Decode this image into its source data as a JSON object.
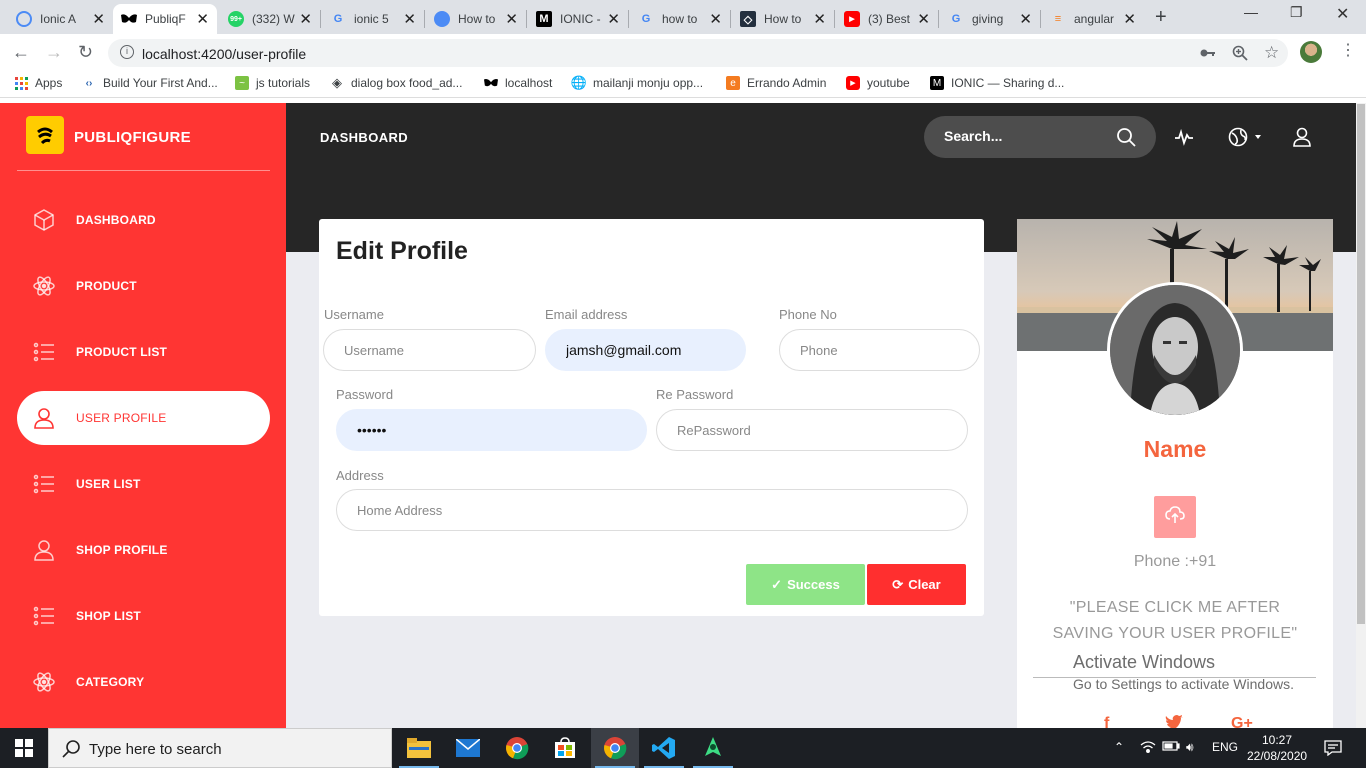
{
  "browser": {
    "tabs": [
      {
        "title": "Ionic A",
        "favicon": "ionic-logo",
        "color": "#4c8bf5"
      },
      {
        "title": "PubliqF",
        "favicon": "mask-icon",
        "color": "#000000"
      },
      {
        "title": "(332) W",
        "favicon": "whatsapp-icon",
        "color": "#25d366"
      },
      {
        "title": "ionic 5",
        "favicon": "google-icon",
        "color": "#4285f4"
      },
      {
        "title": "How to",
        "favicon": "blue-circle-icon",
        "color": "#4c8bf5"
      },
      {
        "title": "IONIC -",
        "favicon": "medium-icon",
        "color": "#000000"
      },
      {
        "title": "how to",
        "favicon": "google-icon",
        "color": "#4285f4"
      },
      {
        "title": "How to",
        "favicon": "dark-diamond-icon",
        "color": "#232f3e"
      },
      {
        "title": "(3) Best",
        "favicon": "youtube-icon",
        "color": "#ff0000"
      },
      {
        "title": "giving",
        "favicon": "google-icon",
        "color": "#4285f4"
      },
      {
        "title": "angular",
        "favicon": "stackoverflow-icon",
        "color": "#f48024"
      }
    ],
    "url": "localhost:4200/user-profile",
    "bookmarks": [
      {
        "label": "Apps",
        "icon": "apps-grid-icon"
      },
      {
        "label": "Build Your First And...",
        "icon": "code-icon"
      },
      {
        "label": "js tutorials",
        "icon": "green-chart-icon"
      },
      {
        "label": "dialog box food_ad...",
        "icon": "diamond-icon"
      },
      {
        "label": "localhost",
        "icon": "mask-icon"
      },
      {
        "label": "mailanji monju opp...",
        "icon": "globe-icon"
      },
      {
        "label": "Errando Admin",
        "icon": "errando-icon"
      },
      {
        "label": "youtube",
        "icon": "youtube-icon"
      },
      {
        "label": "IONIC — Sharing d...",
        "icon": "medium-icon"
      }
    ]
  },
  "brand": {
    "name": "PUBLIQFIGURE",
    "logo_color": "#ffcc00"
  },
  "sidebar": {
    "items": [
      {
        "label": "DASHBOARD",
        "icon": "cube-icon"
      },
      {
        "label": "PRODUCT",
        "icon": "atom-icon"
      },
      {
        "label": "PRODUCT LIST",
        "icon": "list-icon"
      },
      {
        "label": "USER PROFILE",
        "icon": "user-icon",
        "active": true
      },
      {
        "label": "USER LIST",
        "icon": "list-icon"
      },
      {
        "label": "SHOP PROFILE",
        "icon": "user-icon"
      },
      {
        "label": "SHOP LIST",
        "icon": "list-icon"
      },
      {
        "label": "CATEGORY",
        "icon": "atom-icon"
      }
    ]
  },
  "header": {
    "title": "DASHBOARD",
    "search_placeholder": "Search..."
  },
  "form": {
    "title": "Edit Profile",
    "username": {
      "label": "Username",
      "placeholder": "Username",
      "value": ""
    },
    "email": {
      "label": "Email address",
      "placeholder": "",
      "value": "jamsh@gmail.com"
    },
    "phone": {
      "label": "Phone No",
      "placeholder": "Phone",
      "value": ""
    },
    "password": {
      "label": "Password",
      "placeholder": "",
      "value": "••••••"
    },
    "repassword": {
      "label": "Re Password",
      "placeholder": "RePassword",
      "value": ""
    },
    "address": {
      "label": "Address",
      "placeholder": "Home Address",
      "value": ""
    },
    "success_label": "Success",
    "clear_label": "Clear"
  },
  "profile_card": {
    "name": "Name",
    "phone": "Phone :+91",
    "note": "\"PLEASE CLICK ME AFTER SAVING YOUR USER PROFILE\"",
    "accent": "#f4653e"
  },
  "watermark": {
    "title": "Activate Windows",
    "subtitle": "Go to Settings to activate Windows."
  },
  "taskbar": {
    "search_placeholder": "Type here to search",
    "language": "ENG",
    "time": "10:27",
    "date": "22/08/2020"
  }
}
